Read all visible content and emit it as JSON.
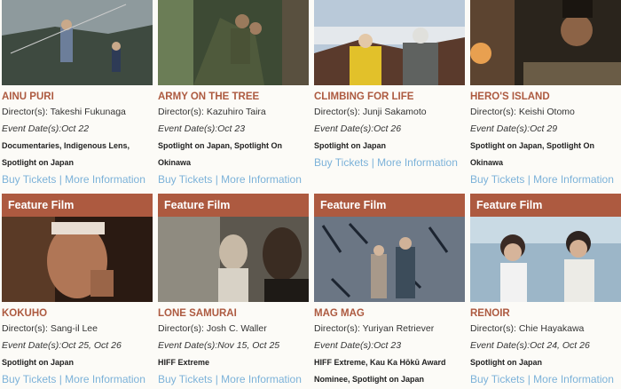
{
  "row1": [
    {
      "title": "AINU PURI",
      "directors_label": "Director(s):",
      "director": "Takeshi Fukunaga",
      "event_label": "Event Date(s):",
      "dates": "Oct 22",
      "categories": "Documentaries, Indigenous Lens, Spotlight on Japan"
    },
    {
      "title": "ARMY ON THE TREE",
      "directors_label": "Director(s):",
      "director": "Kazuhiro Taira",
      "event_label": "Event Date(s):",
      "dates": "Oct 23",
      "categories": "Spotlight on Japan, Spotlight On Okinawa"
    },
    {
      "title": "CLIMBING FOR LIFE",
      "directors_label": "Director(s):",
      "director": "Junji Sakamoto",
      "event_label": "Event Date(s):",
      "dates": "Oct 26",
      "categories": "Spotlight on Japan"
    },
    {
      "title": "HERO'S ISLAND",
      "directors_label": "Director(s):",
      "director": "Keishi Otomo",
      "event_label": "Event Date(s):",
      "dates": "Oct 29",
      "categories": "Spotlight on Japan, Spotlight On Okinawa"
    }
  ],
  "row2": [
    {
      "banner": "Feature Film",
      "title": "KOKUHO",
      "directors_label": "Director(s):",
      "director": "Sang-il Lee",
      "event_label": "Event Date(s):",
      "dates": "Oct 25, Oct 26",
      "categories": "Spotlight on Japan"
    },
    {
      "banner": "Feature Film",
      "title": "LONE SAMURAI",
      "directors_label": "Director(s):",
      "director": "Josh C. Waller",
      "event_label": "Event Date(s):",
      "dates": "Nov 15, Oct 25",
      "categories": "HIFF Extreme"
    },
    {
      "banner": "Feature Film",
      "title": "MAG MAG",
      "directors_label": "Director(s):",
      "director": "Yuriyan Retriever",
      "event_label": "Event Date(s):",
      "dates": "Oct 23",
      "categories": "HIFF Extreme, Kau Ka Hōkū Award Nominee, Spotlight on Japan"
    },
    {
      "banner": "Feature Film",
      "title": "RENOIR",
      "directors_label": "Director(s):",
      "director": "Chie Hayakawa",
      "event_label": "Event Date(s):",
      "dates": "Oct 24, Oct 26",
      "categories": "Spotlight on Japan"
    }
  ],
  "links": {
    "buy": "Buy Tickets",
    "sep": "|",
    "more": "More Information"
  },
  "colors": {
    "accent": "#ad5a40",
    "link": "#7cb2d9",
    "background": "#fcfbf7"
  }
}
